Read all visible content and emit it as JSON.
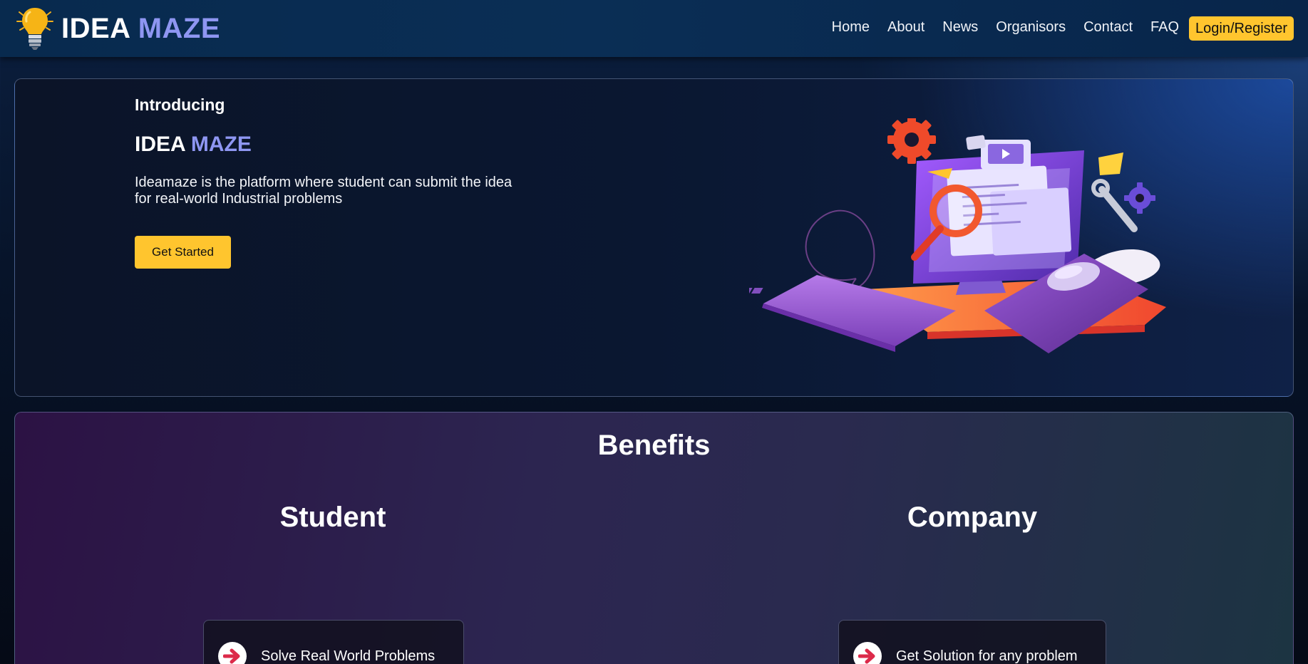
{
  "brand": {
    "word1": "IDEA",
    "word2": "MAZE",
    "icon": "lightbulb-icon",
    "accent_color": "#8e96f2"
  },
  "nav": {
    "links": [
      "Home",
      "About",
      "News",
      "Organisors",
      "Contact",
      "FAQ"
    ],
    "login_label": "Login/Register",
    "login_color": "#ffc52e"
  },
  "hero": {
    "eyebrow": "Introducing",
    "title_word1": "IDEA",
    "title_word2": "MAZE",
    "description": "Ideamaze is the platform where student can submit the idea for real-world Industrial problems",
    "cta_label": "Get Started",
    "illustration": "computer-workspace-illustration"
  },
  "benefits": {
    "title": "Benefits",
    "student": {
      "title": "Student",
      "items": [
        "Solve Real World Problems"
      ]
    },
    "company": {
      "title": "Company",
      "items": [
        "Get Solution for any problem"
      ]
    },
    "item_icon": "arrow-right-circle-icon",
    "icon_color": "#dc2a4a"
  }
}
